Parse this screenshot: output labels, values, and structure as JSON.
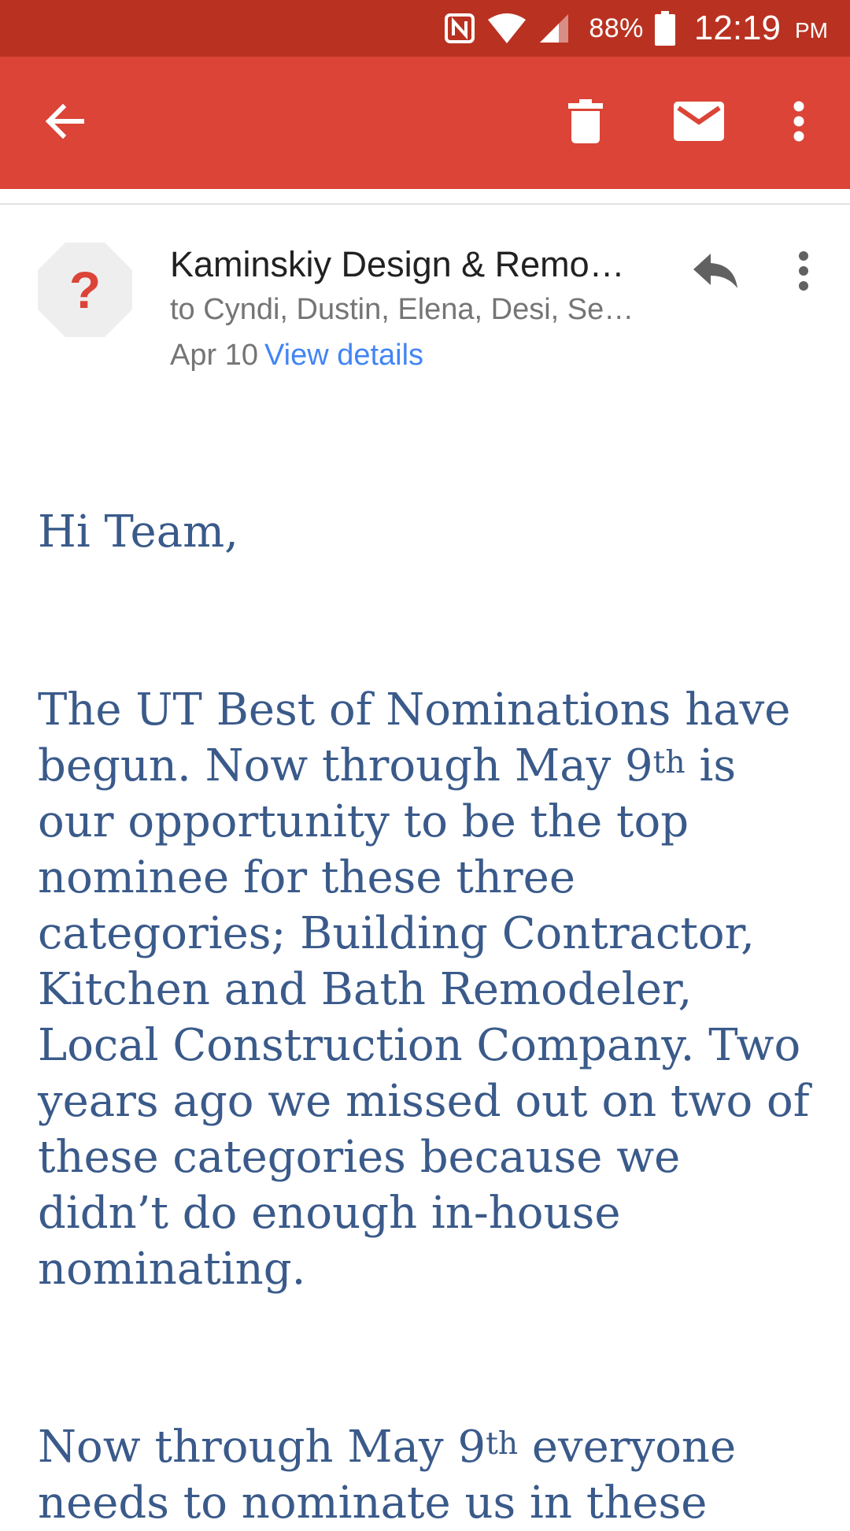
{
  "status_bar": {
    "battery_percent": "88%",
    "time": "12:19",
    "ampm": "PM",
    "icons": [
      "nfc-icon",
      "wifi-icon",
      "cellular-signal-icon",
      "battery-icon"
    ]
  },
  "toolbar": {
    "color": "#db4437",
    "actions": [
      "back-arrow-icon",
      "trash-icon",
      "mail-icon",
      "more-vert-icon"
    ]
  },
  "message": {
    "avatar_symbol": "?",
    "sender": "Kaminskiy Design & Remo…",
    "recipients": "to Cyndi, Dustin, Elena, Desi, Se…",
    "date": "Apr 10",
    "view_details": "View details"
  },
  "body": {
    "greeting": "Hi Team,",
    "para1_a": "The UT Best of Nominations have begun. Now through May 9",
    "para1_sup": "th",
    "para1_b": " is our opportunity to be the top nominee for these three categories; Building Contractor, Kitchen and Bath Remodeler, Local Construction Company. Two years ago we missed out on two of these categories because we didn’t do enough in-house nominating.",
    "para2_a": "Now through May 9",
    "para2_sup": "th",
    "para2_b": " everyone needs to nominate us in these"
  }
}
